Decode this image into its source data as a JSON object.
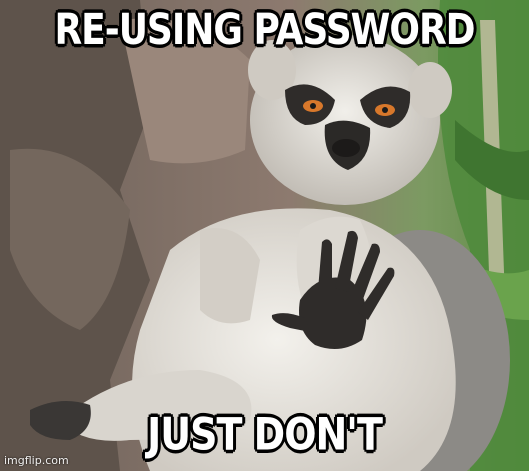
{
  "meme": {
    "top_text": "RE-USING PASSWORD",
    "bottom_text": "JUST DON'T",
    "watermark": "imgflip.com",
    "subject": "lemur-raising-hand"
  },
  "colors": {
    "caption_fill": "#ffffff",
    "caption_outline": "#000000",
    "fur_light": "#e9e6e0",
    "fur_gray": "#8c8a86",
    "face_dark": "#2b2927",
    "eye": "#d8782b",
    "rock": "#6d5f55",
    "foliage": "#4f8a3a"
  }
}
